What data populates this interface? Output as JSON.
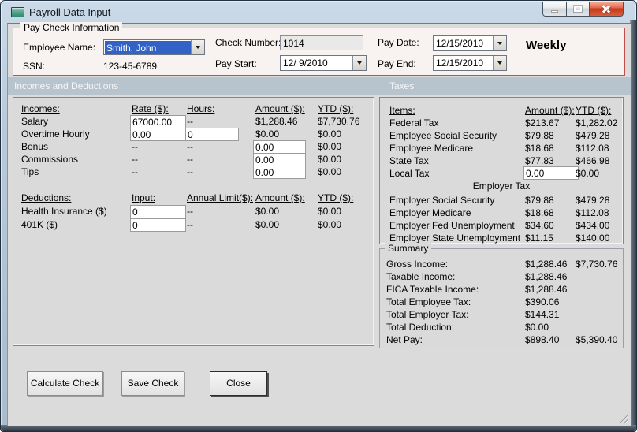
{
  "window": {
    "title": "Payroll Data Input"
  },
  "colors": {
    "group_border_red": "#C14E4C",
    "section_header_bg": "#B7C3CD",
    "selection_blue": "#3262C6",
    "close_button_red": "#C3361C",
    "client_bg": "#DBDBDB"
  },
  "pay_check_info": {
    "legend": "Pay Check Information",
    "employee_name_label": "Employee Name:",
    "employee_name_value": "Smith, John",
    "ssn_label": "SSN:",
    "ssn_value": "123-45-6789",
    "check_number_label": "Check Number:",
    "check_number_value": "1014",
    "pay_start_label": "Pay Start:",
    "pay_start_value": "12/ 9/2010",
    "pay_date_label": "Pay Date:",
    "pay_date_value": "12/15/2010",
    "pay_end_label": "Pay End:",
    "pay_end_value": "12/15/2010",
    "frequency": "Weekly"
  },
  "sections": {
    "incomes_deductions": "Incomes and Deductions",
    "taxes": "Taxes"
  },
  "incomes": {
    "headers": {
      "item": "Incomes:",
      "rate": "Rate ($):",
      "hours": "Hours:",
      "amount": "Amount ($):",
      "ytd": "YTD ($):"
    },
    "salary": {
      "label": "Salary",
      "rate": "67000.00",
      "hours": "--",
      "amount": "$1,288.46",
      "ytd": "$7,730.76"
    },
    "overtime": {
      "label": "Overtime Hourly",
      "rate": "0.00",
      "hours": "0",
      "amount": "$0.00",
      "ytd": "$0.00"
    },
    "bonus": {
      "label": "Bonus",
      "rate": "--",
      "hours": "--",
      "amount": "0.00",
      "ytd": "$0.00"
    },
    "commissions": {
      "label": "Commissions",
      "rate": "--",
      "hours": "--",
      "amount": "0.00",
      "ytd": "$0.00"
    },
    "tips": {
      "label": "Tips",
      "rate": "--",
      "hours": "--",
      "amount": "0.00",
      "ytd": "$0.00"
    }
  },
  "deductions": {
    "headers": {
      "item": "Deductions:",
      "input": "Input:",
      "annual_limit": "Annual Limit($):",
      "amount": "Amount ($):",
      "ytd": "YTD ($):"
    },
    "health_insurance": {
      "label": "Health Insurance ($)",
      "input": "0",
      "annual_limit": "--",
      "amount": "$0.00",
      "ytd": "$0.00"
    },
    "k401": {
      "label": "401K ($)",
      "input": "0",
      "annual_limit": "--",
      "amount": "$0.00",
      "ytd": "$0.00"
    }
  },
  "taxes": {
    "headers": {
      "item": "Items:",
      "amount": "Amount ($):",
      "ytd": "YTD ($):"
    },
    "federal": {
      "label": "Federal Tax",
      "amount": "$213.67",
      "ytd": "$1,282.02"
    },
    "employee_ss": {
      "label": "Employee Social Security",
      "amount": "$79.88",
      "ytd": "$479.28"
    },
    "employee_medicare": {
      "label": "Employee Medicare",
      "amount": "$18.68",
      "ytd": "$112.08"
    },
    "state": {
      "label": "State Tax",
      "amount": "$77.83",
      "ytd": "$466.98"
    },
    "local": {
      "label": "Local Tax",
      "amount": "0.00",
      "ytd": "$0.00"
    },
    "employer_header": "Employer Tax",
    "employer_ss": {
      "label": "Employer Social Security",
      "amount": "$79.88",
      "ytd": "$479.28"
    },
    "employer_medicare": {
      "label": "Employer Medicare",
      "amount": "$18.68",
      "ytd": "$112.08"
    },
    "employer_fed_unemp": {
      "label": "Employer Fed Unemployment",
      "amount": "$34.60",
      "ytd": "$434.00"
    },
    "employer_state_unemp": {
      "label": "Employer State Unemployment",
      "amount": "$11.15",
      "ytd": "$140.00"
    }
  },
  "summary": {
    "legend": "Summary",
    "gross": {
      "label": "Gross Income:",
      "amount": "$1,288.46",
      "ytd": "$7,730.76"
    },
    "taxable": {
      "label": "Taxable Income:",
      "amount": "$1,288.46",
      "ytd": ""
    },
    "fica": {
      "label": "FICA Taxable Income:",
      "amount": "$1,288.46",
      "ytd": ""
    },
    "total_employee_tax": {
      "label": "Total Employee Tax:",
      "amount": "$390.06",
      "ytd": ""
    },
    "total_employer_tax": {
      "label": "Total Employer Tax:",
      "amount": "$144.31",
      "ytd": ""
    },
    "total_deduction": {
      "label": "Total Deduction:",
      "amount": "$0.00",
      "ytd": ""
    },
    "net_pay": {
      "label": "Net Pay:",
      "amount": "$898.40",
      "ytd": "$5,390.40"
    }
  },
  "buttons": {
    "calculate": "Calculate Check",
    "save": "Save Check",
    "close": "Close"
  }
}
